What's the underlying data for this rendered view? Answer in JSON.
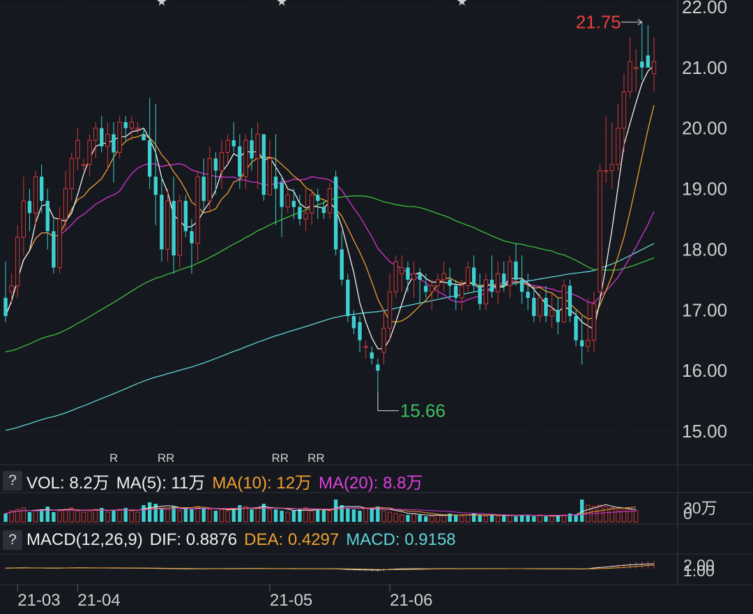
{
  "colors": {
    "background": "#15181e",
    "up": "#d13a3a",
    "down": "#3fd1d1",
    "ma5": "#f5f5f5",
    "ma10": "#f0a030",
    "ma20": "#d633d6",
    "ma60": "#3fbf3f",
    "ma120": "#5fd6d6",
    "grid": "#2a2e36",
    "label": "#cfcfcf"
  },
  "price_axis": {
    "ticks": [
      "15.00",
      "16.00",
      "17.00",
      "18.00",
      "19.00",
      "20.00",
      "21.00",
      "22.00"
    ]
  },
  "date_axis": {
    "ticks": [
      "21-03",
      "21-04",
      "21-05",
      "21-06"
    ]
  },
  "annotations": {
    "high_label": "21.75",
    "low_label": "15.66",
    "star_glyph": "★",
    "rr_labels": [
      "R",
      "RR",
      "RR",
      "RR"
    ]
  },
  "volume_panel": {
    "help_icon": "?",
    "title": "VOL: 8.2万",
    "ma5_label": "MA(5): 11万",
    "ma10_label": "MA(10): 12万",
    "ma20_label": "MA(20): 8.8万",
    "axis_label_top": "30万",
    "axis_label_zero": "0"
  },
  "macd_panel": {
    "help_icon": "?",
    "title": "MACD(12,26,9)",
    "dif_label": "DIF: 0.8876",
    "dea_label": "DEA: 0.4297",
    "macd_label": "MACD: 0.9158",
    "axis_label_top": "2.00",
    "axis_label_mid": "1.00"
  },
  "chart_data": [
    {
      "type": "candlestick",
      "title": "",
      "xlabel": "",
      "ylabel": "",
      "ylim": [
        14.5,
        22.0
      ],
      "x_range": [
        "2021-02-25",
        "2021-06-30"
      ],
      "grid": true,
      "ohlc": [
        [
          17.2,
          17.8,
          16.8,
          16.9
        ],
        [
          17.3,
          17.6,
          17.1,
          17.4
        ],
        [
          17.4,
          18.4,
          17.2,
          18.2
        ],
        [
          18.2,
          19.2,
          17.9,
          18.8
        ],
        [
          18.8,
          19.0,
          18.3,
          18.6
        ],
        [
          18.6,
          19.3,
          18.4,
          19.2
        ],
        [
          19.2,
          19.4,
          18.6,
          18.8
        ],
        [
          18.8,
          19.0,
          18.0,
          18.3
        ],
        [
          18.3,
          18.5,
          17.6,
          17.7
        ],
        [
          17.7,
          18.7,
          17.6,
          18.5
        ],
        [
          18.5,
          19.3,
          18.3,
          19.0
        ],
        [
          19.0,
          19.6,
          18.8,
          19.5
        ],
        [
          19.5,
          20.0,
          19.3,
          19.8
        ],
        [
          19.4,
          19.5,
          19.3,
          19.4
        ],
        [
          19.4,
          19.9,
          19.2,
          19.8
        ],
        [
          19.8,
          20.1,
          19.5,
          20.0
        ],
        [
          20.0,
          20.2,
          19.6,
          19.7
        ],
        [
          19.7,
          20.1,
          19.3,
          19.9
        ],
        [
          19.9,
          20.1,
          19.1,
          19.6
        ],
        [
          19.6,
          20.2,
          19.5,
          20.1
        ],
        [
          20.1,
          20.2,
          19.8,
          20.0
        ],
        [
          20.0,
          20.2,
          19.8,
          20.1
        ],
        [
          20.0,
          20.1,
          19.9,
          20.0
        ],
        [
          19.9,
          20.0,
          19.8,
          19.8
        ],
        [
          19.8,
          20.5,
          19.0,
          19.2
        ],
        [
          19.2,
          20.4,
          18.4,
          18.9
        ],
        [
          18.9,
          19.2,
          17.8,
          18.0
        ],
        [
          18.0,
          19.0,
          17.8,
          18.8
        ],
        [
          18.8,
          19.2,
          17.6,
          17.9
        ],
        [
          17.9,
          18.9,
          17.7,
          18.8
        ],
        [
          18.8,
          18.9,
          18.2,
          18.3
        ],
        [
          18.3,
          18.5,
          17.6,
          18.1
        ],
        [
          18.1,
          19.3,
          17.8,
          19.2
        ],
        [
          19.2,
          19.5,
          18.6,
          18.8
        ],
        [
          18.8,
          19.7,
          18.6,
          19.5
        ],
        [
          19.5,
          19.6,
          18.9,
          19.3
        ],
        [
          19.3,
          19.8,
          19.0,
          19.6
        ],
        [
          19.6,
          19.9,
          19.4,
          19.8
        ],
        [
          19.8,
          20.1,
          19.6,
          19.7
        ],
        [
          19.7,
          19.9,
          19.0,
          19.2
        ],
        [
          19.2,
          19.9,
          19.0,
          19.8
        ],
        [
          19.8,
          20.0,
          19.3,
          19.5
        ],
        [
          19.5,
          20.1,
          19.0,
          19.9
        ],
        [
          19.9,
          19.9,
          18.8,
          18.9
        ],
        [
          18.9,
          19.8,
          18.9,
          19.5
        ],
        [
          19.2,
          19.9,
          18.4,
          19.0
        ],
        [
          19.1,
          19.2,
          18.2,
          18.7
        ],
        [
          18.7,
          19.0,
          18.6,
          18.9
        ],
        [
          18.8,
          19.0,
          18.5,
          18.7
        ],
        [
          18.7,
          18.9,
          18.4,
          18.5
        ],
        [
          18.5,
          19.0,
          18.3,
          18.6
        ],
        [
          18.6,
          19.0,
          18.4,
          18.9
        ],
        [
          18.9,
          19.0,
          18.5,
          18.8
        ],
        [
          18.7,
          18.8,
          18.5,
          18.6
        ],
        [
          18.6,
          19.1,
          18.5,
          19.0
        ],
        [
          19.2,
          19.3,
          17.9,
          18.0
        ],
        [
          18.0,
          18.3,
          17.4,
          17.5
        ],
        [
          17.5,
          17.6,
          16.8,
          16.9
        ],
        [
          16.9,
          17.0,
          16.6,
          16.7
        ],
        [
          16.8,
          16.9,
          16.3,
          16.5
        ],
        [
          16.4,
          16.5,
          16.2,
          16.4
        ],
        [
          16.3,
          16.4,
          16.1,
          16.2
        ],
        [
          16.1,
          16.2,
          15.66,
          16.0
        ],
        [
          16.3,
          17.0,
          16.1,
          16.7
        ],
        [
          16.7,
          17.6,
          16.5,
          17.3
        ],
        [
          17.3,
          17.9,
          17.2,
          17.8
        ],
        [
          17.6,
          17.9,
          17.3,
          17.7
        ],
        [
          17.7,
          17.8,
          17.3,
          17.5
        ],
        [
          17.5,
          17.8,
          17.2,
          17.6
        ],
        [
          17.6,
          17.7,
          17.1,
          17.5
        ],
        [
          17.4,
          17.6,
          17.2,
          17.3
        ],
        [
          17.3,
          17.5,
          17.0,
          17.4
        ],
        [
          17.4,
          17.6,
          17.2,
          17.5
        ],
        [
          17.5,
          17.8,
          17.3,
          17.6
        ],
        [
          17.5,
          17.7,
          17.2,
          17.4
        ],
        [
          17.4,
          17.5,
          17.0,
          17.2
        ],
        [
          17.2,
          17.5,
          17.0,
          17.4
        ],
        [
          17.4,
          17.8,
          17.3,
          17.7
        ],
        [
          17.7,
          17.9,
          17.3,
          17.4
        ],
        [
          17.4,
          17.6,
          17.0,
          17.1
        ],
        [
          17.1,
          17.6,
          17.0,
          17.5
        ],
        [
          17.5,
          17.9,
          17.2,
          17.3
        ],
        [
          17.3,
          17.8,
          17.1,
          17.6
        ],
        [
          17.6,
          17.8,
          17.3,
          17.4
        ],
        [
          17.4,
          17.9,
          17.2,
          17.8
        ],
        [
          17.8,
          18.1,
          17.4,
          17.5
        ],
        [
          17.5,
          17.9,
          17.1,
          17.3
        ],
        [
          17.3,
          17.6,
          17.0,
          17.2
        ],
        [
          17.2,
          17.4,
          16.8,
          16.9
        ],
        [
          16.9,
          17.3,
          16.8,
          17.2
        ],
        [
          17.2,
          17.4,
          16.8,
          16.9
        ],
        [
          16.9,
          17.3,
          16.7,
          17.0
        ],
        [
          17.0,
          17.2,
          16.6,
          16.8
        ],
        [
          16.8,
          17.5,
          16.8,
          17.4
        ],
        [
          17.4,
          17.5,
          16.8,
          16.9
        ],
        [
          16.9,
          17.0,
          16.4,
          16.5
        ],
        [
          16.5,
          16.9,
          16.1,
          16.4
        ],
        [
          16.4,
          17.2,
          16.3,
          16.5
        ],
        [
          16.5,
          17.3,
          16.3,
          17.1
        ],
        [
          17.3,
          19.4,
          17.2,
          19.3
        ],
        [
          19.3,
          20.2,
          19.1,
          19.3
        ],
        [
          19.3,
          20.1,
          19.0,
          19.4
        ],
        [
          19.4,
          20.4,
          19.3,
          20.0
        ],
        [
          20.0,
          20.9,
          19.6,
          20.6
        ],
        [
          20.6,
          21.5,
          20.5,
          21.1
        ],
        [
          21.0,
          21.3,
          20.6,
          21.0
        ],
        [
          21.1,
          21.75,
          20.8,
          21.0
        ],
        [
          21.2,
          21.7,
          21.0,
          21.0
        ],
        [
          20.9,
          21.5,
          20.6,
          21.1
        ]
      ],
      "volume": [
        6,
        8,
        9,
        10,
        7,
        8,
        9,
        11,
        7,
        8,
        9,
        10,
        8,
        7,
        8,
        9,
        10,
        7,
        8,
        9,
        10,
        8,
        7,
        12,
        14,
        13,
        10,
        9,
        11,
        8,
        10,
        9,
        11,
        10,
        9,
        8,
        9,
        8,
        10,
        12,
        11,
        9,
        10,
        13,
        9,
        9,
        8,
        7,
        8,
        9,
        10,
        8,
        9,
        9,
        8,
        16,
        12,
        10,
        9,
        8,
        10,
        9,
        11,
        8,
        7,
        6,
        5,
        5,
        6,
        5,
        4,
        4,
        5,
        5,
        6,
        5,
        4,
        5,
        6,
        5,
        4,
        5,
        4,
        5,
        5,
        4,
        5,
        5,
        4,
        5,
        4,
        4,
        5,
        5,
        6,
        5,
        16,
        12,
        11,
        12,
        11,
        10,
        8,
        9,
        9,
        8
      ],
      "macd": [
        0.08,
        0.09,
        0.12,
        0.14,
        0.12,
        0.11,
        0.1,
        0.08,
        0.06,
        0.08,
        0.1,
        0.12,
        0.14,
        0.13,
        0.12,
        0.12,
        0.11,
        0.1,
        0.09,
        0.09,
        0.08,
        0.07,
        0.06,
        0.05,
        0.04,
        0.02,
        -0.01,
        -0.02,
        -0.04,
        -0.05,
        -0.06,
        -0.07,
        -0.06,
        -0.06,
        -0.05,
        -0.04,
        -0.03,
        -0.02,
        -0.02,
        -0.02,
        -0.01,
        -0.01,
        -0.01,
        -0.02,
        -0.02,
        -0.03,
        -0.04,
        -0.04,
        -0.05,
        -0.05,
        -0.05,
        -0.04,
        -0.05,
        -0.05,
        -0.05,
        -0.08,
        -0.12,
        -0.18,
        -0.22,
        -0.25,
        -0.28,
        -0.3,
        -0.32,
        -0.26,
        -0.18,
        -0.12,
        -0.08,
        -0.06,
        -0.05,
        -0.05,
        -0.06,
        -0.06,
        -0.05,
        -0.04,
        -0.04,
        -0.05,
        -0.05,
        -0.04,
        -0.04,
        -0.05,
        -0.04,
        -0.04,
        -0.03,
        -0.03,
        -0.03,
        -0.04,
        -0.04,
        -0.05,
        -0.05,
        -0.06,
        -0.06,
        -0.07,
        -0.06,
        -0.06,
        -0.08,
        -0.1,
        -0.1,
        -0.06,
        0.1,
        0.2,
        0.28,
        0.4,
        0.52,
        0.64,
        0.72,
        0.8,
        0.86,
        0.9,
        0.92
      ],
      "ma_lines": [
        "MA5",
        "MA10",
        "MA20",
        "MA60",
        "MA120"
      ]
    }
  ]
}
